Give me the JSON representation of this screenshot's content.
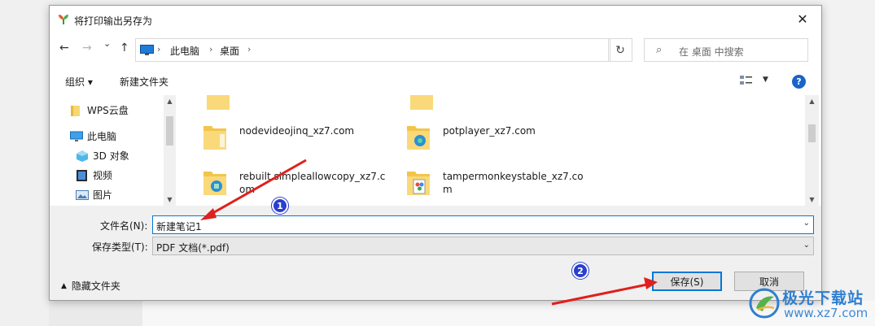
{
  "window": {
    "title": "将打印输出另存为",
    "close_label": "✕"
  },
  "navigation": {
    "back": "←",
    "forward": "→",
    "recent": "⌄",
    "up": "↑",
    "breadcrumbs": [
      "此电脑",
      "桌面"
    ],
    "separator": "›",
    "refresh": "↻",
    "search_placeholder": "在 桌面 中搜索"
  },
  "toolbar": {
    "organize_label": "组织 ▾",
    "new_folder_label": "新建文件夹",
    "help_label": "?"
  },
  "sidebar": {
    "items": [
      {
        "label": "WPS云盘",
        "icon": "folder-icon"
      },
      {
        "label": "此电脑",
        "icon": "computer-icon"
      },
      {
        "label": "3D 对象",
        "icon": "3d-objects-icon"
      },
      {
        "label": "视频",
        "icon": "video-icon"
      },
      {
        "label": "图片",
        "icon": "pictures-icon"
      }
    ]
  },
  "files": [
    {
      "name": "nodevideojinq_xz7.com",
      "icon": "folder-icon"
    },
    {
      "name": "potplayer_xz7.com",
      "icon": "folder-icon"
    },
    {
      "name": "rebuilt.simpleallowcopy_xz7.com",
      "icon": "folder-icon"
    },
    {
      "name": "tampermonkeystable_xz7.com",
      "icon": "folder-icon"
    }
  ],
  "form": {
    "filename_label": "文件名(N):",
    "filename_value": "新建笔记1",
    "filetype_label": "保存类型(T):",
    "filetype_value": "PDF 文档(*.pdf)"
  },
  "buttons": {
    "hide_folders": "隐藏文件夹",
    "save": "保存(S)",
    "cancel": "取消"
  },
  "annotations": {
    "step1": "1",
    "step2": "2"
  },
  "watermark": {
    "title": "极光下载站",
    "url": "www.xz7.com"
  },
  "colors": {
    "accent": "#0078d7",
    "arrow": "#e0201c",
    "marker": "#2a3fcf"
  }
}
